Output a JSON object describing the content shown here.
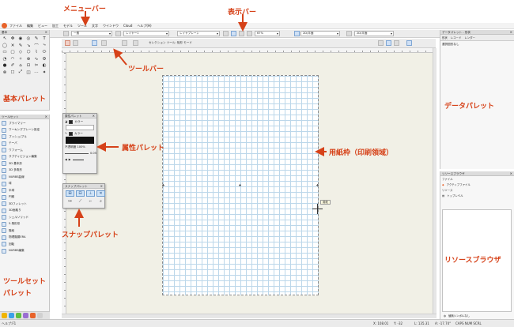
{
  "menu": {
    "items": [
      "ファイル",
      "編集",
      "ビュー",
      "加工",
      "モデル",
      "ツール",
      "文字",
      "ウインドウ",
      "Cloud",
      "ヘルプ(H)"
    ]
  },
  "view_bar": {
    "class_select": "一般",
    "layer_select": "レイヤー1",
    "plane_select": "レイヤプレーン",
    "zoom": "67%",
    "view_select": "2D/平面",
    "render_select": "2D/平面"
  },
  "tool_bar": {
    "mode_label": "セレクション ツール: 矩形 モード"
  },
  "basic_palette": {
    "title": "基本",
    "tools": [
      "↖",
      "✥",
      "◉",
      "◎",
      "✎",
      "T",
      "◯",
      "✕",
      "✎",
      "↘",
      "⌒",
      "⤷",
      "▭",
      "▢",
      "◇",
      "⬡",
      "⌇",
      "⬭",
      "◔",
      "◠",
      "✧",
      "⊕",
      "∿",
      "⚙",
      "●",
      "✐",
      "⌂",
      "⊡",
      "✂",
      "◐",
      "⊗",
      "☐",
      "⤢",
      "◫",
      "⋯",
      "✦"
    ]
  },
  "toolset_palette": {
    "title": "ツールセット",
    "items": [
      "プライマリー",
      "ワーキングプレーン設定",
      "プッシュ/プル",
      "テーパ",
      "ワフォーム",
      "サブディビジョン編集",
      "3D 基本形",
      "3D 多角形",
      "NURBS曲線",
      "球",
      "半球",
      "円錐",
      "3Dフィレット",
      "3D面取り",
      "シェルソリッド",
      "5-角形形",
      "階段",
      "物理階層ERA",
      "回転",
      "NURBS編集"
    ],
    "tab_colors": [
      "#f0b400",
      "#3aa0e8",
      "#5fbf3f",
      "#9a6fd1",
      "#e8632a",
      "#d0d0d0"
    ]
  },
  "attribute_palette": {
    "title": "属性パレット",
    "fill_label": "カラー",
    "pen_label": "カラー",
    "opacity_label": "不透明度 100%",
    "scale_value": "0.05"
  },
  "snap_palette": {
    "title": "スナップパレット",
    "row1": [
      "⊞",
      "⊟",
      "⊥",
      "✕"
    ],
    "row2": [
      "⊶",
      "⟋",
      "⌐",
      "⌕"
    ]
  },
  "canvas": {
    "tooltip": "用紙"
  },
  "data_palette": {
    "title": "データパレット - 形状",
    "tabs": [
      "形状",
      "レコード",
      "レンダー"
    ],
    "empty_text": "選択図形なし"
  },
  "resource_palette": {
    "title": "リソースブラウザ",
    "file_label": "ファイル",
    "file_value": "アクティブファイル",
    "resource_label": "リソース",
    "resource_value": "トップレベル",
    "footer": "値無シンボルなし"
  },
  "status_bar": {
    "help": "ヘルプ:F1",
    "x": "X: 108.01",
    "y": "Y: -32",
    "l": "L: 135.31",
    "a": "A: -17.74°",
    "caps": "CAPS NUM SCRL"
  },
  "annotations": {
    "menu_bar": "メニューバー",
    "view_bar": "表示バー",
    "tool_bar": "ツールバー",
    "basic_palette": "基本パレット",
    "attribute_palette": "属性パレット",
    "paper_frame": "用紙枠（印刷領域）",
    "snap_palette": "スナップパレット",
    "toolset_palette_1": "ツールセット",
    "toolset_palette_2": "パレット",
    "data_palette": "データパレット",
    "resource_browser": "リソースブラウザ",
    "color": "#d64219"
  }
}
